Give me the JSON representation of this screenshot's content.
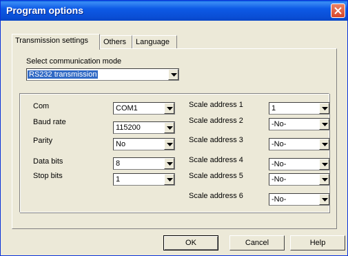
{
  "window": {
    "title": "Program options"
  },
  "tabs": [
    {
      "label": "Transmission settings"
    },
    {
      "label": "Others"
    },
    {
      "label": "Language"
    }
  ],
  "mode": {
    "label": "Select communication mode",
    "value": "RS232 transmission"
  },
  "serial": {
    "com": {
      "label": "Com",
      "value": "COM1"
    },
    "baud": {
      "label": "Baud rate",
      "value": "115200"
    },
    "parity": {
      "label": "Parity",
      "value": "No"
    },
    "data_bits": {
      "label": "Data bits",
      "value": "8"
    },
    "stop_bits": {
      "label": "Stop bits",
      "value": "1"
    }
  },
  "scales": [
    {
      "label": "Scale address 1",
      "value": "1"
    },
    {
      "label": "Scale address 2",
      "value": "-No-"
    },
    {
      "label": "Scale address 3",
      "value": "-No-"
    },
    {
      "label": "Scale address 4",
      "value": "-No-"
    },
    {
      "label": "Scale address 5",
      "value": "-No-"
    },
    {
      "label": "Scale address 6",
      "value": "-No-"
    }
  ],
  "buttons": {
    "ok": "OK",
    "cancel": "Cancel",
    "help": "Help"
  },
  "icons": {
    "close": "close-icon",
    "dropdown": "chevron-down-icon"
  },
  "colors": {
    "title_bar": "#0a4fd6",
    "selection": "#316ac5",
    "close": "#d8462a",
    "face": "#ece9d8"
  }
}
